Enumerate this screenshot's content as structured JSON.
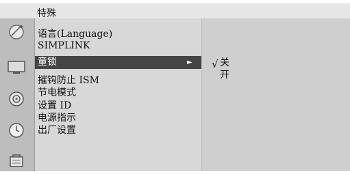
{
  "header": {
    "title": "特殊"
  },
  "sidebar": {
    "icons": [
      {
        "name": "satellite-dish-icon"
      },
      {
        "name": "tv-screen-icon"
      },
      {
        "name": "speaker-icon"
      },
      {
        "name": "clock-icon"
      },
      {
        "name": "lock-box-icon"
      }
    ]
  },
  "menu": {
    "items": [
      {
        "label": "语言(Language)"
      },
      {
        "label": "SIMPLINK"
      },
      {
        "label": "童锁",
        "selected": true
      },
      {
        "label": "摧钩防止 ISM"
      },
      {
        "label": "节电模式"
      },
      {
        "label": "设置 ID"
      },
      {
        "label": "电源指示"
      },
      {
        "label": "出厂设置"
      }
    ],
    "selected_arrow": "►"
  },
  "submenu": {
    "checkmark": "√",
    "options": [
      {
        "label": "关",
        "checked": true
      },
      {
        "label": "开",
        "checked": false
      }
    ]
  },
  "colors": {
    "title_bar": "#e6e6e6",
    "icon_bar": "#bdbdbd",
    "menu_panel": "#d8d8d8",
    "sub_panel": "#cfcfcf",
    "selected_item": "#454545"
  }
}
